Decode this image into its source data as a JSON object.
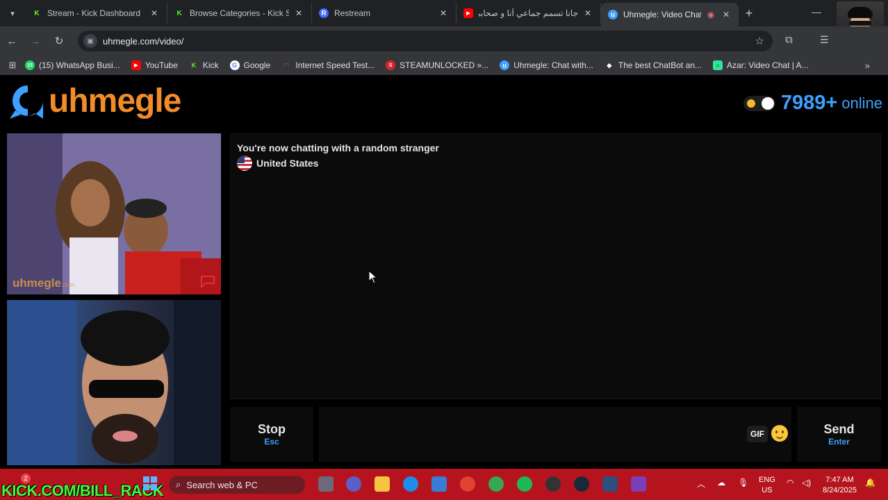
{
  "browser": {
    "tabs": [
      {
        "title": "Stream - Kick Dashboard",
        "fav": "K",
        "fav_color": "#53fc18"
      },
      {
        "title": "Browse Categories - Kick Str",
        "fav": "K",
        "fav_color": "#53fc18"
      },
      {
        "title": "Restream",
        "fav": "R",
        "fav_color": "#3b6cff"
      },
      {
        "title": "جانا تسمم جماعي أنا و صحابي",
        "fav": "▶",
        "fav_color": "#ff0000"
      },
      {
        "title": "Uhmegle: Video Chat | C",
        "fav": "u",
        "fav_color": "#3ea1ff",
        "active": true
      }
    ],
    "url": "uhmegle.com/video/",
    "bookmarks": [
      {
        "label": "(15) WhatsApp Busi...",
        "fav": "15",
        "color": "#25d366"
      },
      {
        "label": "YouTube",
        "fav": "▶",
        "color": "#ff0000"
      },
      {
        "label": "Kick",
        "fav": "K",
        "color": "#53fc18"
      },
      {
        "label": "Google",
        "fav": "G",
        "color": "#4285f4"
      },
      {
        "label": "Internet Speed Test...",
        "fav": "◠",
        "color": "#d62828"
      },
      {
        "label": "STEAMUNLOCKED »...",
        "fav": "S",
        "color": "#d62828"
      },
      {
        "label": "Uhmegle: Chat with...",
        "fav": "u",
        "color": "#3ea1ff"
      },
      {
        "label": "The best ChatBot an...",
        "fav": "◆",
        "color": "#ffffff"
      },
      {
        "label": "Azar: Video Chat | A...",
        "fav": "a",
        "color": "#2ee59d"
      }
    ]
  },
  "site": {
    "logo_text": "uhmegle",
    "online_count": "7989+",
    "online_label": "online",
    "watermark": "uhmegle",
    "watermark_suffix": ".com"
  },
  "chat": {
    "status": "You're now chatting with a random stranger",
    "country": "United States"
  },
  "controls": {
    "stop_label": "Stop",
    "stop_hint": "Esc",
    "gif_label": "GIF",
    "send_label": "Send",
    "send_hint": "Enter"
  },
  "taskbar": {
    "overlay_text": "KICK.COM/BILL_RACK",
    "notif_count": "2",
    "search_placeholder": "Search web & PC",
    "lang_line1": "ENG",
    "lang_line2": "US",
    "time": "7:47 AM",
    "date": "8/24/2025"
  },
  "colors": {
    "accent_blue": "#3ea1ff",
    "logo_orange": "#f28c28",
    "taskbar_red": "#b5141f"
  }
}
